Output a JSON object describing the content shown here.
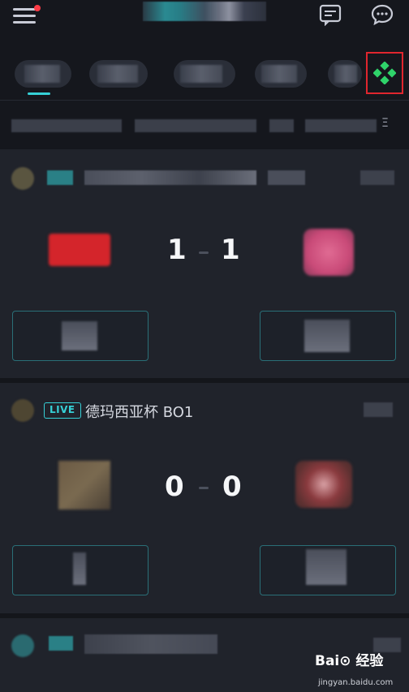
{
  "header": {
    "menu_icon": "menu-icon",
    "messages_icon": "message-icon",
    "chat_icon": "chat-icon"
  },
  "tabs": {
    "game_icon": "diamond-grid-icon",
    "accent": "#36d0d6"
  },
  "filter_row": {
    "more_label": "Ξ"
  },
  "matches": [
    {
      "score_home": "1",
      "score_away": "1"
    },
    {
      "live_label": "LIVE",
      "league": "德玛西亚杯  BO1",
      "score_home": "0",
      "score_away": "0"
    }
  ],
  "watermark": {
    "brand": "Bai⊙ 经验",
    "url": "jingyan.baidu.com"
  }
}
